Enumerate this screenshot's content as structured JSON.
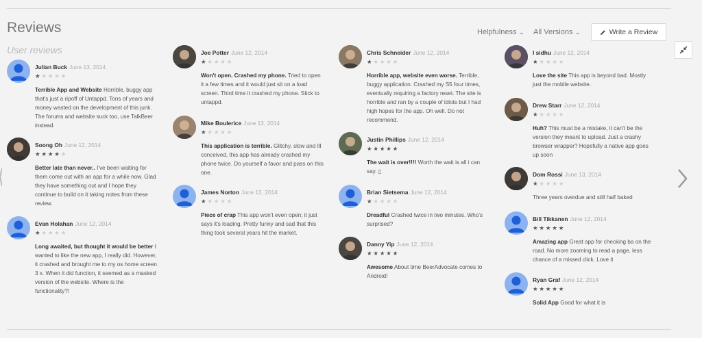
{
  "header": {
    "title": "Reviews",
    "subtitle": "User reviews",
    "sort_label": "Helpfulness",
    "filter_label": "All Versions",
    "write_label": "Write a Review"
  },
  "icons": {
    "pencil": "pencil-icon",
    "collapse": "collapse-icon",
    "next": "chevron-right-icon"
  },
  "columns": [
    [
      {
        "name": "Julian Buck",
        "date": "June 13, 2014",
        "stars": 1,
        "avatar": "default",
        "title": "Terrible App and Website",
        "text": "Horrible, buggy app that's just a ripoff of Untappd. Tons of years and money wasted on the development of this junk. The forums and website suck too, use TalkBeer instead."
      },
      {
        "name": "Soong Oh",
        "date": "June 12, 2014",
        "stars": 4,
        "avatar": "photo",
        "title": "Better late than never..",
        "text": "I've been waiting for them come out with an app for a while now. Glad they have something out and I hope they continue to build on it taking notes from these review."
      },
      {
        "name": "Evan Holahan",
        "date": "June 12, 2014",
        "stars": 1,
        "avatar": "default",
        "title": "Long awaited, but thought it would be better",
        "text": "I wanted to like the new app, I really did. However, it crashed and brought me to my os home screen 3 x. When it did function, it seemed as a masked version of the website. Where is the functionality?!"
      }
    ],
    [
      {
        "name": "Joe Potter",
        "date": "June 12, 2014",
        "stars": 1,
        "avatar": "photo",
        "title": "Won't open. Crashed my phone.",
        "text": "Tried to open it a few times and it would just sit on a load screen. Third time it crashed my phone. Stick to untappd."
      },
      {
        "name": "Mike Boulerice",
        "date": "June 12, 2014",
        "stars": 1,
        "avatar": "photo",
        "title": "This application is terrible.",
        "text": "Glitchy, slow and Ill conceived, this app has already crashed my phone twice. Do yourself a favor and pass on this one."
      },
      {
        "name": "James Norton",
        "date": "June 12, 2014",
        "stars": 1,
        "avatar": "default",
        "title": "Piece of crap",
        "text": "This app won't even open; it just says it's loading. Pretty funny and sad that this thing took several years hit the market."
      }
    ],
    [
      {
        "name": "Chris Schneider",
        "date": "June 12, 2014",
        "stars": 1,
        "avatar": "photo",
        "title": "Horrible app, website even worse.",
        "text": "Terrible, buggy application. Crashed my S5 four times, eventually requiring a factory reset. The site is horrible and ran by a couple of idiots but I had high hopes for the app. Oh well. Do not recommend."
      },
      {
        "name": "Justin Phillips",
        "date": "June 12, 2014",
        "stars": 5,
        "avatar": "photo",
        "title": "The wait is over!!!!",
        "text": "Worth the wait is all i can say. ▯"
      },
      {
        "name": "Brian Sietsema",
        "date": "June 12, 2014",
        "stars": 1,
        "avatar": "default",
        "title": "Dreadful",
        "text": "Crashed twice in two minutes. Who's surprised?"
      },
      {
        "name": "Danny Yip",
        "date": "June 12, 2014",
        "stars": 5,
        "avatar": "photo",
        "title": "Awesome",
        "text": "About time BeerAdvocate comes to Android!"
      }
    ],
    [
      {
        "name": "I sidhu",
        "date": "June 12, 2014",
        "stars": 1,
        "avatar": "photo",
        "title": "Love the site",
        "text": "This app is beyond bad. Mostly just the mobile website."
      },
      {
        "name": "Drew Starr",
        "date": "June 12, 2014",
        "stars": 1,
        "avatar": "photo",
        "title": "Huh?",
        "text": "This must be a mistake, it can't be the version they meant to upload. Just a crashy browser wrapper? Hopefully a native app goes up soon"
      },
      {
        "name": "Dom Rossi",
        "date": "June 13, 2014",
        "stars": 1,
        "avatar": "photo",
        "title": "",
        "text": "Three years overdue and still half baked"
      },
      {
        "name": "Bill Tikkanen",
        "date": "June 12, 2014",
        "stars": 5,
        "avatar": "default",
        "title": "Amazing app",
        "text": "Great app for checking ba on the road. No more zooming to read a page, less chance of a missed click. Love it"
      },
      {
        "name": "Ryan Graf",
        "date": "June 12, 2014",
        "stars": 5,
        "avatar": "default",
        "title": "Solid App",
        "text": "Good for what it is"
      }
    ]
  ]
}
